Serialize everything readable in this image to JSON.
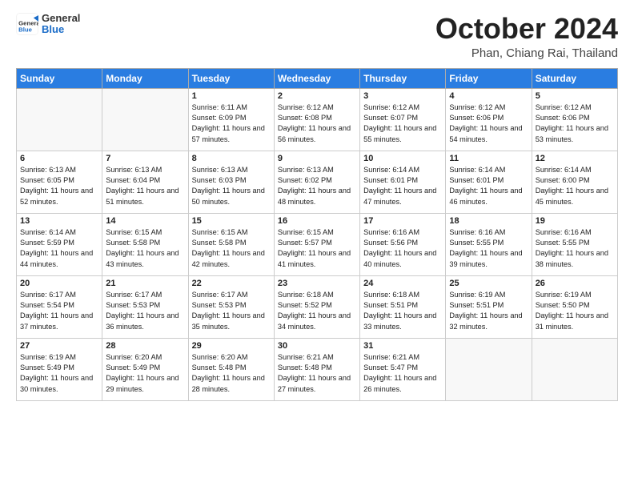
{
  "header": {
    "logo_general": "General",
    "logo_blue": "Blue",
    "title": "October 2024",
    "location": "Phan, Chiang Rai, Thailand"
  },
  "weekdays": [
    "Sunday",
    "Monday",
    "Tuesday",
    "Wednesday",
    "Thursday",
    "Friday",
    "Saturday"
  ],
  "weeks": [
    [
      {
        "day": "",
        "info": ""
      },
      {
        "day": "",
        "info": ""
      },
      {
        "day": "1",
        "info": "Sunrise: 6:11 AM\nSunset: 6:09 PM\nDaylight: 11 hours and 57 minutes."
      },
      {
        "day": "2",
        "info": "Sunrise: 6:12 AM\nSunset: 6:08 PM\nDaylight: 11 hours and 56 minutes."
      },
      {
        "day": "3",
        "info": "Sunrise: 6:12 AM\nSunset: 6:07 PM\nDaylight: 11 hours and 55 minutes."
      },
      {
        "day": "4",
        "info": "Sunrise: 6:12 AM\nSunset: 6:06 PM\nDaylight: 11 hours and 54 minutes."
      },
      {
        "day": "5",
        "info": "Sunrise: 6:12 AM\nSunset: 6:06 PM\nDaylight: 11 hours and 53 minutes."
      }
    ],
    [
      {
        "day": "6",
        "info": "Sunrise: 6:13 AM\nSunset: 6:05 PM\nDaylight: 11 hours and 52 minutes."
      },
      {
        "day": "7",
        "info": "Sunrise: 6:13 AM\nSunset: 6:04 PM\nDaylight: 11 hours and 51 minutes."
      },
      {
        "day": "8",
        "info": "Sunrise: 6:13 AM\nSunset: 6:03 PM\nDaylight: 11 hours and 50 minutes."
      },
      {
        "day": "9",
        "info": "Sunrise: 6:13 AM\nSunset: 6:02 PM\nDaylight: 11 hours and 48 minutes."
      },
      {
        "day": "10",
        "info": "Sunrise: 6:14 AM\nSunset: 6:01 PM\nDaylight: 11 hours and 47 minutes."
      },
      {
        "day": "11",
        "info": "Sunrise: 6:14 AM\nSunset: 6:01 PM\nDaylight: 11 hours and 46 minutes."
      },
      {
        "day": "12",
        "info": "Sunrise: 6:14 AM\nSunset: 6:00 PM\nDaylight: 11 hours and 45 minutes."
      }
    ],
    [
      {
        "day": "13",
        "info": "Sunrise: 6:14 AM\nSunset: 5:59 PM\nDaylight: 11 hours and 44 minutes."
      },
      {
        "day": "14",
        "info": "Sunrise: 6:15 AM\nSunset: 5:58 PM\nDaylight: 11 hours and 43 minutes."
      },
      {
        "day": "15",
        "info": "Sunrise: 6:15 AM\nSunset: 5:58 PM\nDaylight: 11 hours and 42 minutes."
      },
      {
        "day": "16",
        "info": "Sunrise: 6:15 AM\nSunset: 5:57 PM\nDaylight: 11 hours and 41 minutes."
      },
      {
        "day": "17",
        "info": "Sunrise: 6:16 AM\nSunset: 5:56 PM\nDaylight: 11 hours and 40 minutes."
      },
      {
        "day": "18",
        "info": "Sunrise: 6:16 AM\nSunset: 5:55 PM\nDaylight: 11 hours and 39 minutes."
      },
      {
        "day": "19",
        "info": "Sunrise: 6:16 AM\nSunset: 5:55 PM\nDaylight: 11 hours and 38 minutes."
      }
    ],
    [
      {
        "day": "20",
        "info": "Sunrise: 6:17 AM\nSunset: 5:54 PM\nDaylight: 11 hours and 37 minutes."
      },
      {
        "day": "21",
        "info": "Sunrise: 6:17 AM\nSunset: 5:53 PM\nDaylight: 11 hours and 36 minutes."
      },
      {
        "day": "22",
        "info": "Sunrise: 6:17 AM\nSunset: 5:53 PM\nDaylight: 11 hours and 35 minutes."
      },
      {
        "day": "23",
        "info": "Sunrise: 6:18 AM\nSunset: 5:52 PM\nDaylight: 11 hours and 34 minutes."
      },
      {
        "day": "24",
        "info": "Sunrise: 6:18 AM\nSunset: 5:51 PM\nDaylight: 11 hours and 33 minutes."
      },
      {
        "day": "25",
        "info": "Sunrise: 6:19 AM\nSunset: 5:51 PM\nDaylight: 11 hours and 32 minutes."
      },
      {
        "day": "26",
        "info": "Sunrise: 6:19 AM\nSunset: 5:50 PM\nDaylight: 11 hours and 31 minutes."
      }
    ],
    [
      {
        "day": "27",
        "info": "Sunrise: 6:19 AM\nSunset: 5:49 PM\nDaylight: 11 hours and 30 minutes."
      },
      {
        "day": "28",
        "info": "Sunrise: 6:20 AM\nSunset: 5:49 PM\nDaylight: 11 hours and 29 minutes."
      },
      {
        "day": "29",
        "info": "Sunrise: 6:20 AM\nSunset: 5:48 PM\nDaylight: 11 hours and 28 minutes."
      },
      {
        "day": "30",
        "info": "Sunrise: 6:21 AM\nSunset: 5:48 PM\nDaylight: 11 hours and 27 minutes."
      },
      {
        "day": "31",
        "info": "Sunrise: 6:21 AM\nSunset: 5:47 PM\nDaylight: 11 hours and 26 minutes."
      },
      {
        "day": "",
        "info": ""
      },
      {
        "day": "",
        "info": ""
      }
    ]
  ]
}
